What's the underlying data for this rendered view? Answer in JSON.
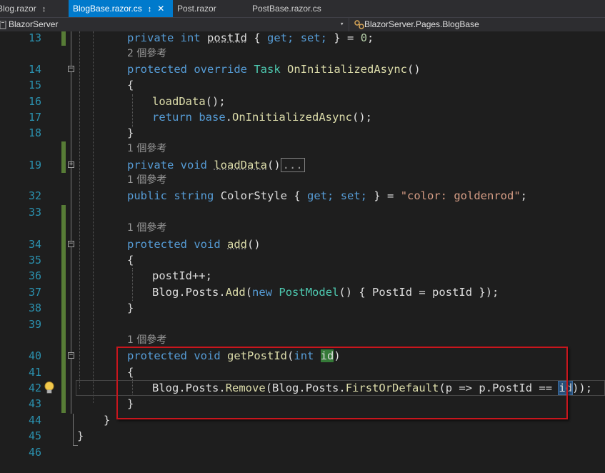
{
  "tabs": [
    {
      "label": "Blog.razor",
      "pinned": true,
      "active": false
    },
    {
      "label": "BlogBase.razor.cs",
      "pinned": true,
      "active": true
    },
    {
      "label": "Post.razor",
      "active": false
    },
    {
      "label": "PostBase.razor.cs",
      "active": false
    }
  ],
  "tab_pin_glyph": "↕",
  "tab_close_glyph": "✕",
  "navbar": {
    "project": "BlazorServer",
    "member": "BlazorServer.Pages.BlogBase",
    "dropdown_glyph": "▾"
  },
  "codelens_text": "1 個參考",
  "codelens_text_2": "2 個參考",
  "lines": {
    "l13": {
      "num": "13",
      "text": "private int postId { get; set; } = 0;"
    },
    "l14": {
      "num": "14",
      "text": "protected override Task OnInitializedAsync()"
    },
    "l15": {
      "num": "15",
      "text": "{"
    },
    "l16": {
      "num": "16",
      "text": "loadData();"
    },
    "l17": {
      "num": "17",
      "text": "return base.OnInitializedAsync();"
    },
    "l18": {
      "num": "18",
      "text": "}"
    },
    "l19": {
      "num": "19",
      "text": "private void loadData()",
      "collapsed": "..."
    },
    "l32": {
      "num": "32",
      "text": "public string ColorStyle { get; set; } = \"color: goldenrod\";"
    },
    "l33": {
      "num": "33",
      "text": ""
    },
    "l34": {
      "num": "34",
      "text": "protected void add()"
    },
    "l35": {
      "num": "35",
      "text": "{"
    },
    "l36": {
      "num": "36",
      "text": "postId++;"
    },
    "l37": {
      "num": "37",
      "text": "Blog.Posts.Add(new PostModel() { PostId = postId });"
    },
    "l38": {
      "num": "38",
      "text": "}"
    },
    "l39": {
      "num": "39",
      "text": ""
    },
    "l40": {
      "num": "40",
      "text": "protected void getPostId(int id)"
    },
    "l41": {
      "num": "41",
      "text": "{"
    },
    "l42": {
      "num": "42",
      "text": "Blog.Posts.Remove(Blog.Posts.FirstOrDefault(p => p.PostId == id));"
    },
    "l43": {
      "num": "43",
      "text": "}"
    },
    "l44": {
      "num": "44",
      "text": "}"
    },
    "l45": {
      "num": "45",
      "text": "}"
    },
    "l46": {
      "num": "46",
      "text": ""
    }
  },
  "tokens": {
    "private": "private",
    "int": "int",
    "get": "get;",
    "set": "set;",
    "protected": "protected",
    "override": "override",
    "Task": "Task",
    "OnInitializedAsync": "OnInitializedAsync",
    "loadData": "loadData",
    "return": "return",
    "base": "base",
    "void": "void",
    "public": "public",
    "string": "string",
    "ColorStyle": "ColorStyle",
    "color_str": "\"color: goldenrod\"",
    "add": "add",
    "postId": "postId",
    "Blog": "Blog",
    "Posts": "Posts",
    "Add": "Add",
    "new": "new",
    "PostModel": "PostModel",
    "PostId": "PostId",
    "getPostId": "getPostId",
    "id": "id",
    "Remove": "Remove",
    "FirstOrDefault": "FirstOrDefault",
    "p": "p",
    "zero": "0"
  },
  "colors": {
    "keyword": "#569cd6",
    "type": "#4ec9b0",
    "method": "#dcdcaa",
    "string": "#d69d85",
    "line_number": "#2b91af",
    "change_bar": "#577c36",
    "annotation_box": "#c8161d",
    "active_tab": "#007acc"
  },
  "icons": [
    "pin-icon",
    "close-icon",
    "csharp-project-icon",
    "class-member-icon",
    "dropdown-arrow-icon",
    "lightbulb-icon",
    "fold-toggle-icon"
  ]
}
